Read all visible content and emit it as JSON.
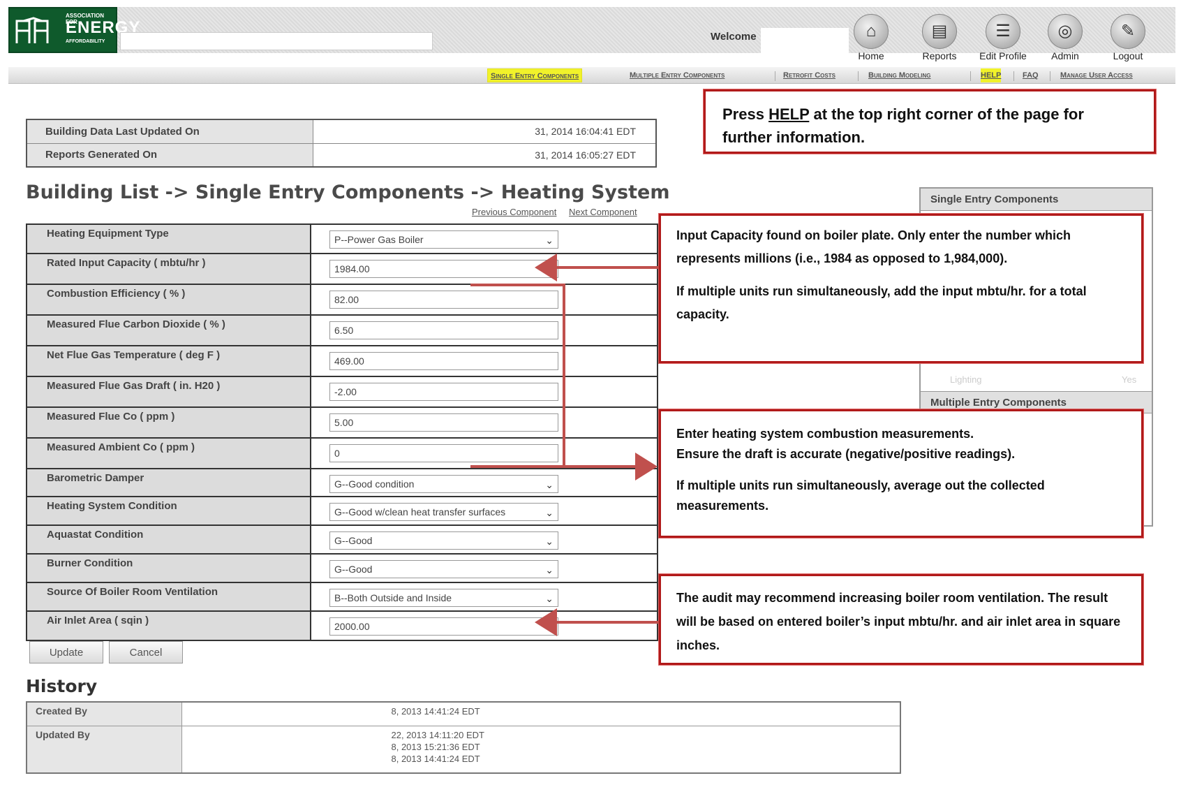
{
  "header": {
    "logo_small": "ASSOCIATION FOR",
    "logo_big": "ENERGY",
    "logo_sub": "AFFORDABILITY",
    "welcome": "Welcome",
    "nav": [
      {
        "label": "Home",
        "icon": "home-icon"
      },
      {
        "label": "Reports",
        "icon": "reports-icon"
      },
      {
        "label": "Edit Profile",
        "icon": "edit-profile-icon"
      },
      {
        "label": "Admin",
        "icon": "admin-icon"
      },
      {
        "label": "Logout",
        "icon": "logout-icon"
      }
    ]
  },
  "subnav": [
    "Single Entry Components",
    "Multiple Entry Components",
    "Retrofit Costs",
    "Building Modeling",
    "HELP",
    "FAQ",
    "Manage User Access"
  ],
  "info": {
    "updated_label": "Building Data Last Updated On",
    "updated_value": "31, 2014 16:04:41 EDT",
    "generated_label": "Reports Generated On",
    "generated_value": "31, 2014 16:05:27 EDT"
  },
  "page_title": "Building List -> Single Entry Components -> Heating System",
  "links": {
    "previous": "Previous Component",
    "next": "Next Component"
  },
  "form": {
    "rows": [
      {
        "label": "Heating Equipment Type",
        "value": "P--Power Gas Boiler"
      },
      {
        "label": "Rated Input Capacity ( mbtu/hr )",
        "value": "1984.00"
      },
      {
        "label": "Combustion Efficiency ( % )",
        "value": "82.00"
      },
      {
        "label": "Measured Flue Carbon Dioxide ( % )",
        "value": "6.50"
      },
      {
        "label": "Net Flue Gas Temperature ( deg F )",
        "value": "469.00"
      },
      {
        "label": "Measured Flue Gas Draft ( in. H20 )",
        "value": "-2.00"
      },
      {
        "label": "Measured Flue Co ( ppm )",
        "value": "5.00"
      },
      {
        "label": "Measured Ambient Co ( ppm )",
        "value": "0"
      },
      {
        "label": "Barometric Damper",
        "value": "G--Good condition"
      },
      {
        "label": "Heating System Condition",
        "value": "G--Good w/clean heat transfer surfaces"
      },
      {
        "label": "Aquastat Condition",
        "value": "G--Good"
      },
      {
        "label": "Burner Condition",
        "value": "G--Good"
      },
      {
        "label": "Source Of Boiler Room Ventilation",
        "value": "B--Both Outside and Inside"
      },
      {
        "label": "Air Inlet Area ( sqin )",
        "value": "2000.00"
      }
    ],
    "update_label": "Update",
    "cancel_label": "Cancel"
  },
  "history": {
    "title": "History",
    "created_label": "Created By",
    "created_value": "8, 2013 14:41:24 EDT",
    "updated_label": "Updated By",
    "updated_values": [
      "22, 2013 14:11:20 EDT",
      "8, 2013 15:21:36 EDT",
      "8, 2013 14:41:24 EDT"
    ]
  },
  "side_panel": {
    "single_heading": "Single Entry Components",
    "lighting_label": "Lighting",
    "lighting_value": "Yes",
    "multiple_heading": "Multiple Entry Components"
  },
  "callouts": {
    "help": {
      "pre": "Press ",
      "link": "HELP",
      "post": " at the top right corner of the page for further information."
    },
    "capacity": {
      "line1": "Input Capacity found on boiler plate.  Only enter the number which represents millions (i.e., 1984 as opposed to 1,984,000).",
      "line2": "If multiple units run simultaneously, add the input mbtu/hr. for a total capacity."
    },
    "combustion": {
      "line1": "Enter heating system combustion measurements.",
      "line2": "Ensure the draft is accurate (negative/positive readings).",
      "line3": "If multiple units run simultaneously, average out the collected measurements."
    },
    "ventilation": {
      "line1": "The audit may recommend increasing boiler room ventilation. The result will be based on entered boiler’s input mbtu/hr. and air inlet area in square inches."
    }
  },
  "colors": {
    "brand_green": "#0f5a2c",
    "callout_red": "#b11a1a",
    "subnav_highlight": "#f1f22a"
  }
}
